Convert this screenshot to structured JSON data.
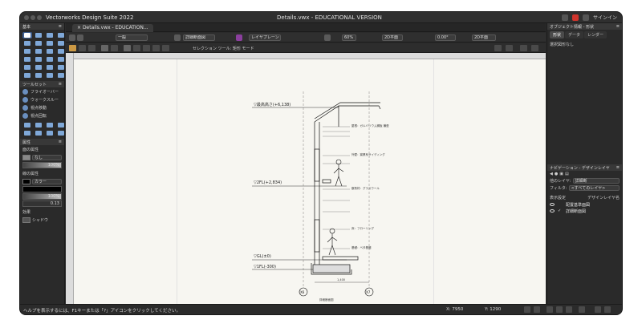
{
  "app": {
    "title": "Vectorworks Design Suite 2022",
    "document_title": "Details.vwx - EDUCATIONAL VERSION",
    "signin": "サインイン"
  },
  "tab": {
    "label": "Details.vwx - EDUCATION..."
  },
  "viewbar": {
    "class": "一般",
    "layer": "詳細断面図",
    "layer_plane": "レイヤプレーン",
    "zoom": "60%",
    "view": "2D平面",
    "angle": "0.00°",
    "view2": "2D平面"
  },
  "modebar": {
    "mode_text": "セレクション ツール: 矩形 モード"
  },
  "left_palette": {
    "basic_title": "基本",
    "toolset_title": "ツールセット",
    "toolset_items": [
      "フライオーバー",
      "ウォークスルー",
      "視点移動",
      "視点回転"
    ],
    "attr_title": "属性",
    "fill_label": "面の属性",
    "fill_value": "なし",
    "fill_opacity": "100%",
    "line_label": "線の属性",
    "line_value": "カラー",
    "line_opacity": "100%",
    "line_weight": "0.13",
    "effects_label": "効果",
    "shadow_label": "シャドウ"
  },
  "right_panel": {
    "obj_title": "オブジェクト情報 - 形状",
    "tabs": [
      "形状",
      "データ",
      "レンダー"
    ],
    "no_selection": "選択図形なし",
    "nav_title": "ナビゲーション - デザインレイヤ",
    "active_layer_label": "他のレイヤ:",
    "active_layer_value": "詳細断",
    "filter_label": "フィルタ:",
    "filter_value": "<すべてのレイヤ>",
    "col_visibility": "表示設定",
    "col_name": "デザインレイヤ名",
    "layers": [
      {
        "name": "配置基準面図",
        "active": false
      },
      {
        "name": "詳細断面図",
        "active": true
      }
    ]
  },
  "status": {
    "help": "ヘルプを表示するには、F1キーまたは「?」アイコンをクリックしてください。",
    "x": "X: 7950",
    "y": "Y: 1290"
  },
  "drawing": {
    "levels": [
      "▽最高高さ(+6,138)",
      "▽2FL(+2,834)",
      "▽GL(±0)",
      "▽1FL(-300)"
    ],
    "grid_markers": [
      "X6",
      "X7"
    ],
    "dimension_note": "1,400",
    "scale_note": "詳細断面図",
    "callouts": [
      "屋根：ガルバリウム鋼板 横葺",
      "外壁：窯業系サイディング",
      "断熱材：グラスウール",
      "床：フローリング",
      "基礎：ベタ基礎"
    ]
  }
}
